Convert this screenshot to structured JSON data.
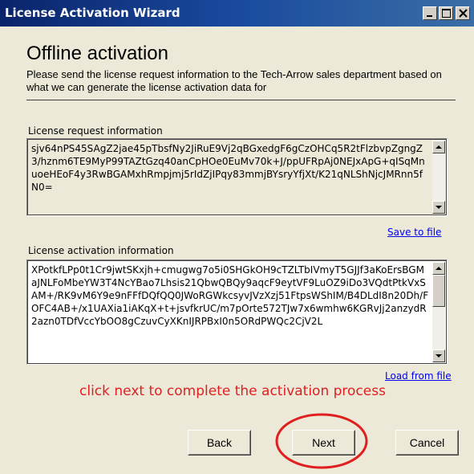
{
  "window": {
    "title": "License Activation Wizard",
    "minimize_icon": "minimize-icon",
    "maximize_icon": "maximize-icon",
    "close_icon": "close-icon"
  },
  "header": {
    "title": "Offline activation",
    "description": "Please send the license request information to the Tech-Arrow sales department based on what we can generate the license activation data for"
  },
  "request": {
    "label": "License request information",
    "text": "sjv64nPS45SAgZ2jae45pTbsfNy2JiRuE9Vj2qBGxedgF6gCzOHCq5R2tFlzbvpZgngZ3/hznm6TE9MyP99TAZtGzq40anCpHOe0EuMv70k+J/ppUFRpAj0NEJxApG+qISqMnuoeHEoF4y3RwBGAMxhRmpjmj5rIdZjIPqy83mmjBYsryYfjXt/K21qNLShNjcJMRnn5fN0=",
    "save_link": "Save to file"
  },
  "activation": {
    "label": "License activation information",
    "text": "XPotkfLPp0t1Cr9jwtSKxjh+cmugwg7o5i0SHGkOH9cTZLTbIVmyT5GJJf3aKoErsBGMaJNLFoMbeYW3T4NcYBao7Lhsis21QbwQBQy9aqcF9eytVF9LuOZ9iDo3VQdtPtkVxSAM+/RK9vM6Y9e9nFFfDQfQQ0JWoRGWkcsyvJVzXzj51FtpsWShIM/B4DLdI8n20Dh/FOFC4AB+/x1UAXia1iAKqX+t+jsvfkrUC/m7pOrte572TJw7x6wmhw6KGRvJj2anzydR2azn0TDfVccYbOO8gCzuvCyXKnIJRPBxI0n5ORdPWQc2CjV2L",
    "load_link": "Load from file"
  },
  "annotation": {
    "text": "click next to complete the activation process",
    "color": "#e02020"
  },
  "buttons": {
    "back": "Back",
    "next": "Next",
    "cancel": "Cancel"
  }
}
